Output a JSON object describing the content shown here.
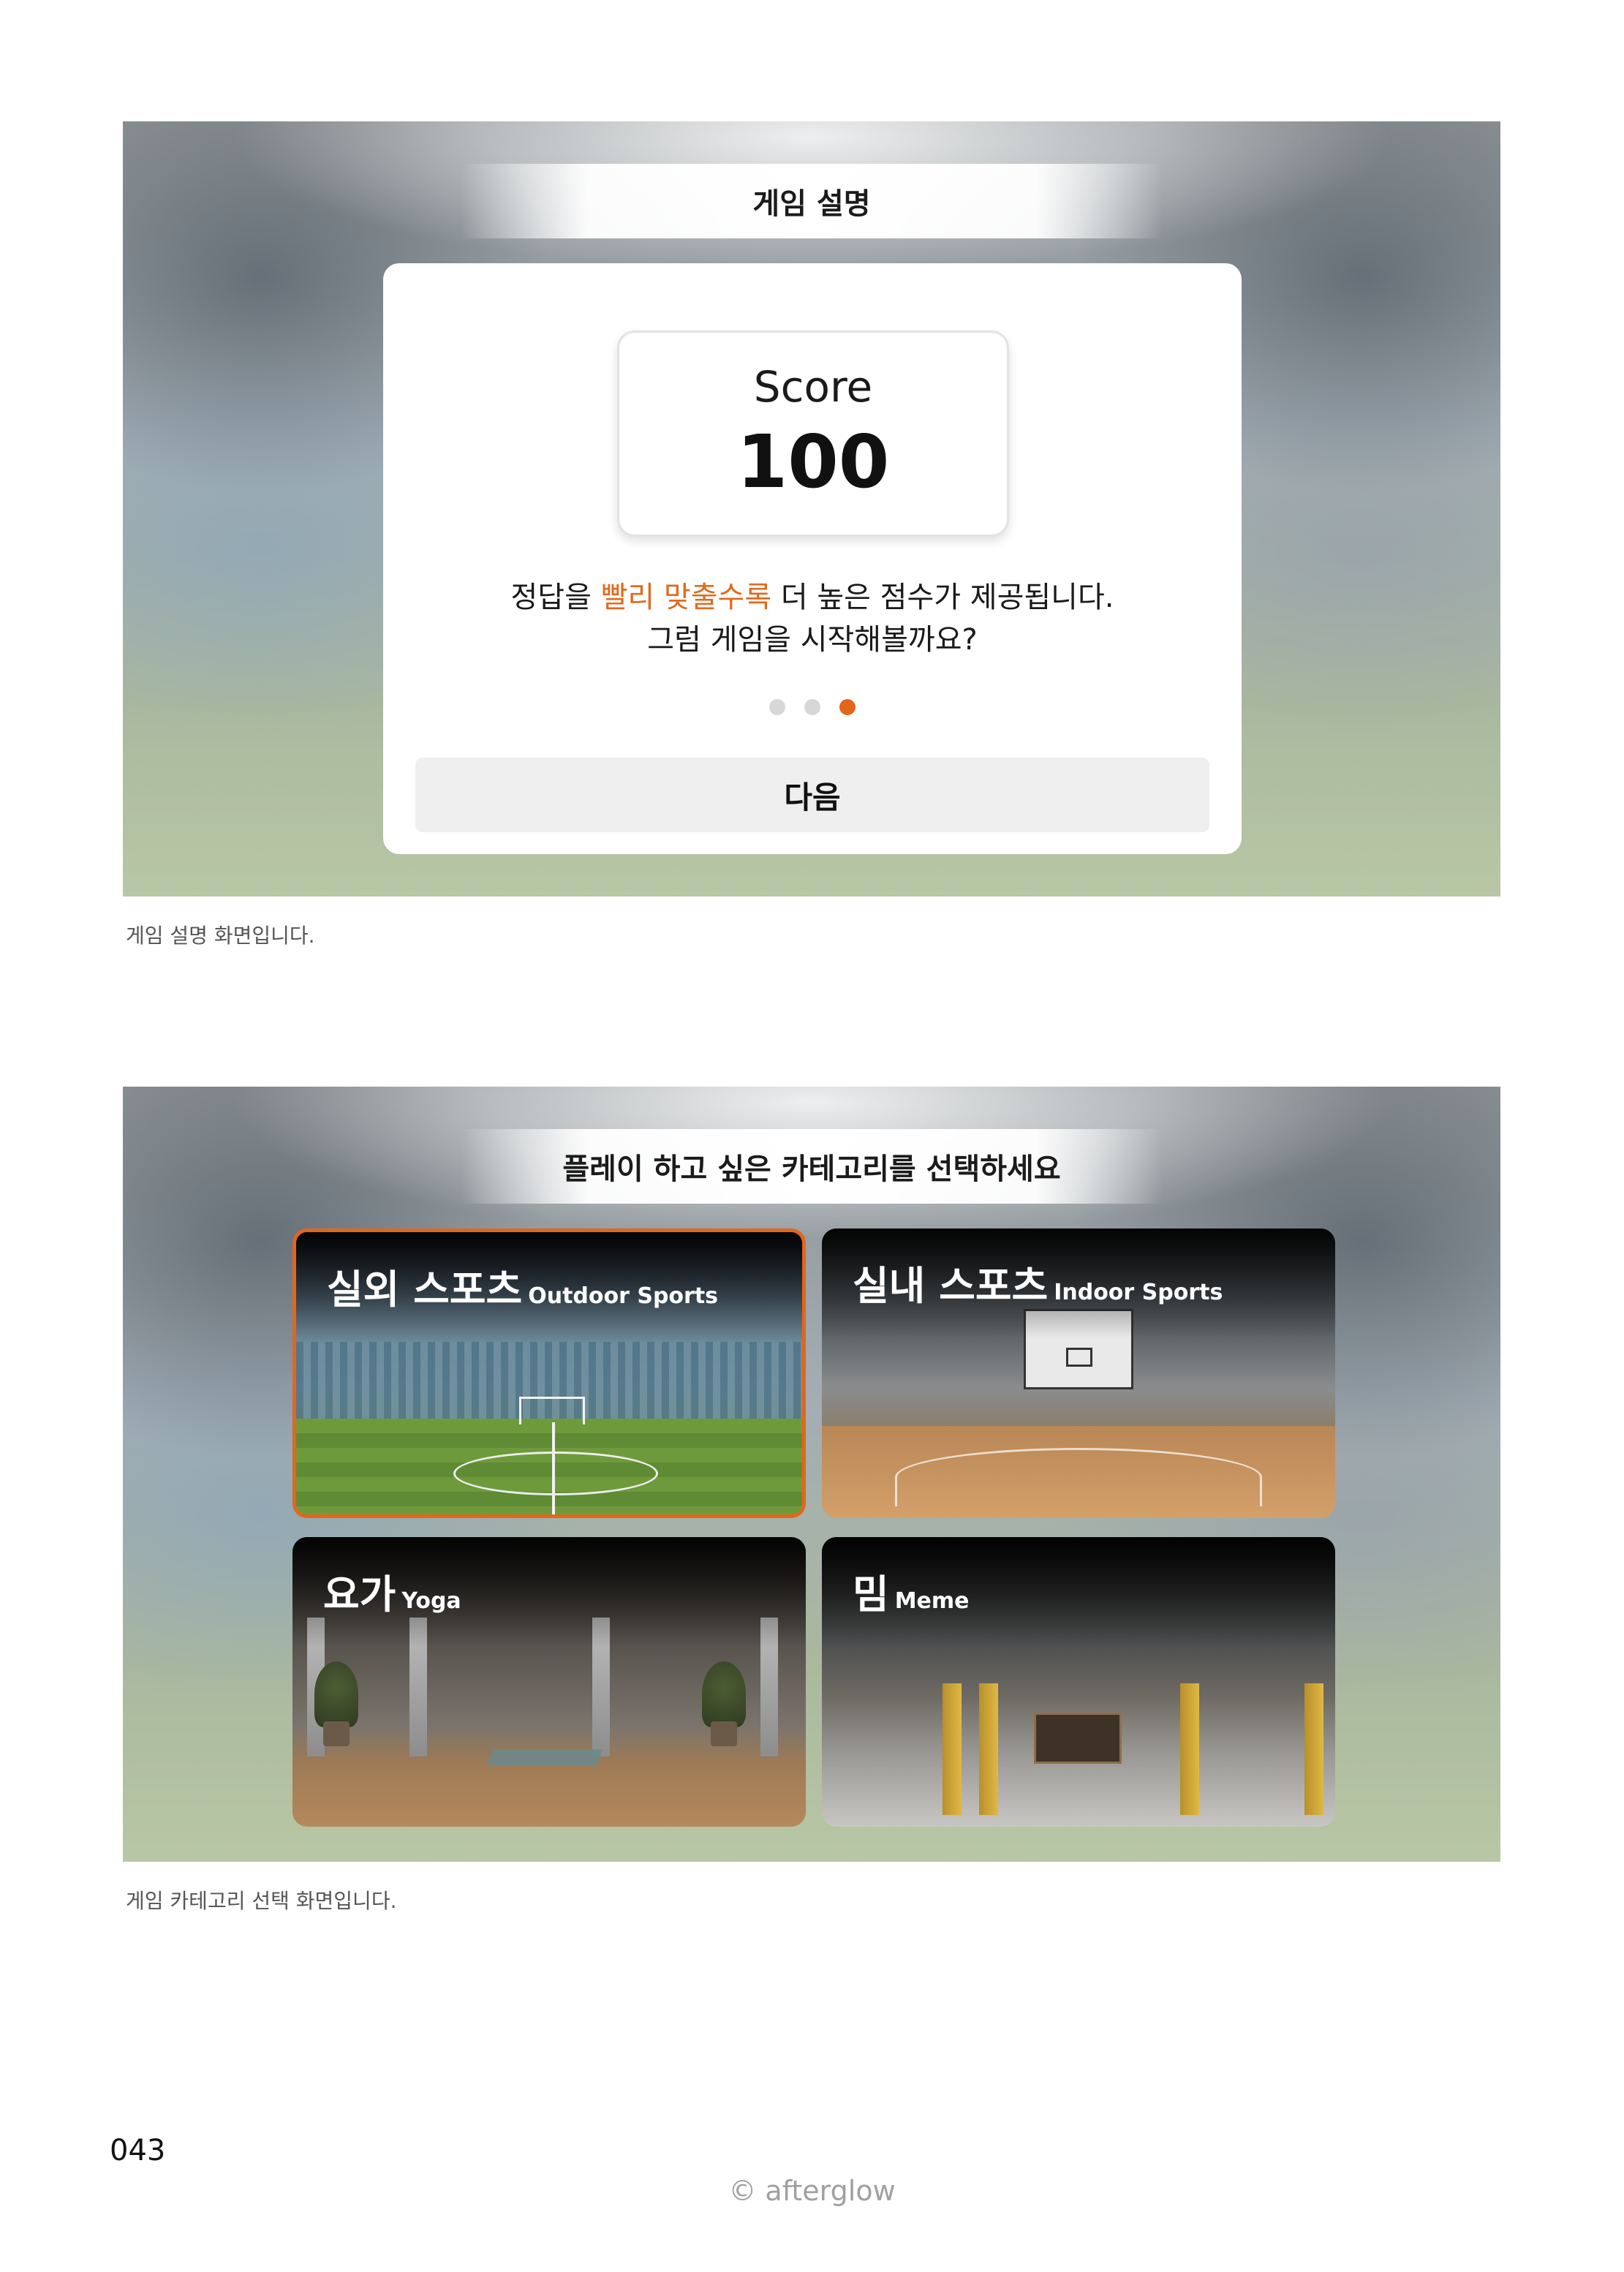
{
  "screen1": {
    "title": "게임 설명",
    "score_label": "Score",
    "score_value": "100",
    "desc_part1": "정답을 ",
    "desc_highlight": "빨리 맞출수록",
    "desc_part2": " 더 높은 점수가 제공됩니다.",
    "desc_line2": "그럼 게임을 시작해볼까요?",
    "page_indicator": {
      "total": 3,
      "active": 3
    },
    "next_button": "다음",
    "highlight_color": "#e2661c"
  },
  "caption1": "게임 설명 화면입니다.",
  "screen2": {
    "title": "플레이 하고 싶은 카테고리를 선택하세요",
    "categories": [
      {
        "name": "실외 스포츠",
        "sub": "Outdoor Sports",
        "selected": true
      },
      {
        "name": "실내 스포츠",
        "sub": "Indoor Sports",
        "selected": false
      },
      {
        "name": "요가",
        "sub": "Yoga",
        "selected": false
      },
      {
        "name": "밈",
        "sub": "Meme",
        "selected": false
      }
    ]
  },
  "caption2": "게임 카테고리 선택 화면입니다.",
  "page_number": "043",
  "footer": "© afterglow"
}
